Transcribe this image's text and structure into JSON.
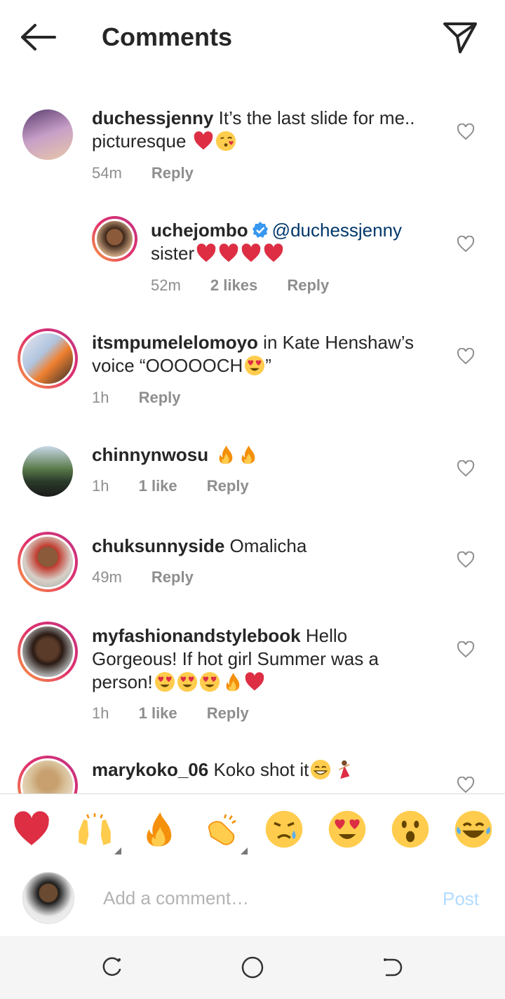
{
  "header": {
    "title": "Comments"
  },
  "comments": [
    {
      "username": "duchessjenny",
      "text": "It’s the last slide for me.. picturesque",
      "emojis": [
        "heart",
        "kiss"
      ],
      "time": "54m",
      "likes": "",
      "reply": "Reply"
    },
    {
      "username": "uchejombo",
      "verified": true,
      "mention": "@duchessjenny",
      "text": "sister",
      "emojis": [
        "heart",
        "heart",
        "heart",
        "heart"
      ],
      "time": "52m",
      "likes": "2 likes",
      "reply": "Reply"
    },
    {
      "username": "itsmpumelelomoyo",
      "text": "in Kate Henshaw’s voice “OOOOOCH",
      "emojis": [
        "heart-eyes"
      ],
      "text_after": "”",
      "time": "1h",
      "likes": "",
      "reply": "Reply"
    },
    {
      "username": "chinnynwosu",
      "text": "",
      "emojis": [
        "fire",
        "fire"
      ],
      "time": "1h",
      "likes": "1 like",
      "reply": "Reply"
    },
    {
      "username": "chuksunnyside",
      "text": "Omalicha",
      "emojis": [],
      "time": "49m",
      "likes": "",
      "reply": "Reply"
    },
    {
      "username": "myfashionandstylebook",
      "text": "Hello Gorgeous! If hot girl Summer was a person!",
      "emojis": [
        "heart-eyes",
        "heart-eyes",
        "heart-eyes",
        "fire",
        "heart"
      ],
      "time": "1h",
      "likes": "1 like",
      "reply": "Reply"
    },
    {
      "username": "marykoko_06",
      "text": "Koko shot it",
      "emojis": [
        "grin",
        "dancer"
      ],
      "time": "",
      "likes": "",
      "reply": ""
    }
  ],
  "reactions": [
    "heart",
    "raised-hands",
    "fire",
    "clap",
    "sad-tear",
    "heart-eyes",
    "surprised",
    "joy"
  ],
  "composer": {
    "placeholder": "Add a comment…",
    "post_label": "Post",
    "post_color": "#b3dbff"
  },
  "colors": {
    "text": "#262626",
    "meta": "#8e8e8e",
    "mention": "#00376b",
    "verified": "#3897f0"
  }
}
